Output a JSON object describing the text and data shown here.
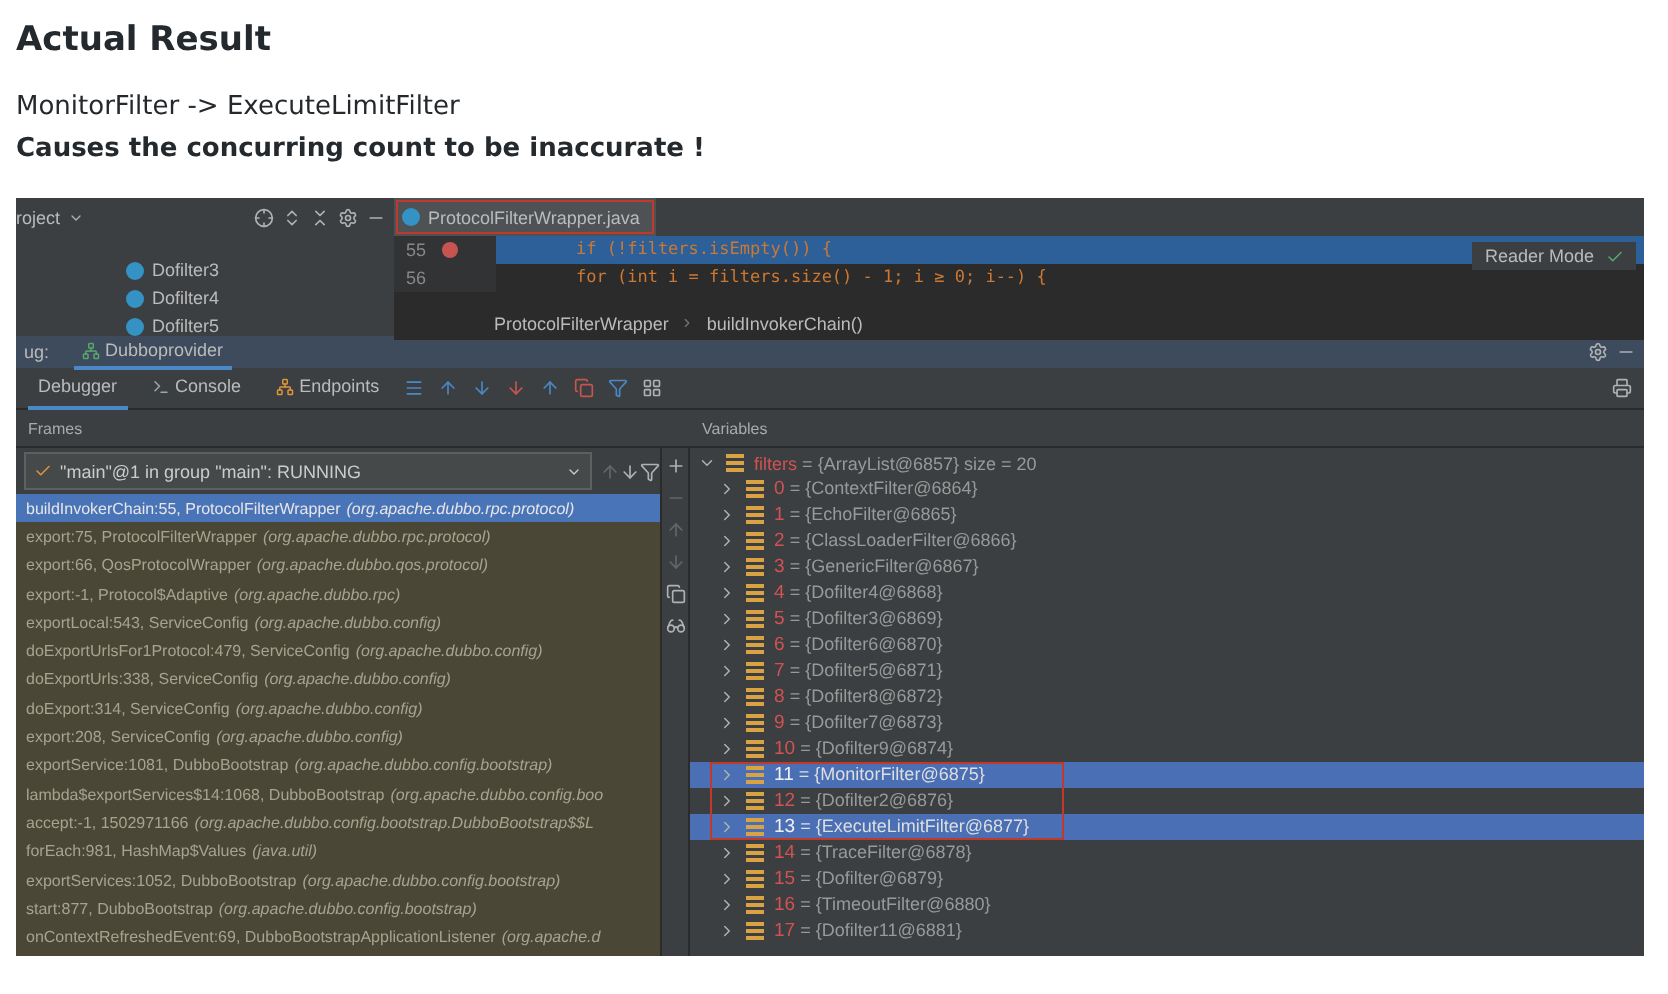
{
  "heading": "Actual Result",
  "lines": [
    {
      "text": "MonitorFilter -> ExecuteLimitFilter",
      "bold": false
    },
    {
      "text": "Causes the concurring count to be inaccurate !",
      "bold": true
    }
  ],
  "ide": {
    "project": {
      "title": "roject",
      "items": [
        "Dofilter3",
        "Dofilter4",
        "Dofilter5"
      ]
    },
    "editor": {
      "tab": {
        "label": "ProtocolFilterWrapper.java",
        "annotated": true
      },
      "lines": [
        {
          "number": "55",
          "code": "if (!filters.isEmpty()) {",
          "highlighted": true,
          "breakpoint": true
        },
        {
          "number": "56",
          "code": "for (int i = filters.size() - 1; i ≥ 0; i--) {",
          "highlighted": false,
          "breakpoint": false
        }
      ],
      "reader_mode": "Reader Mode",
      "breadcrumb": [
        "ProtocolFilterWrapper",
        "buildInvokerChain()"
      ]
    },
    "debug": {
      "label": "ug:",
      "session": "Dubboprovider",
      "tabs": [
        {
          "label": "Debugger",
          "selected": true
        },
        {
          "label": "Console",
          "selected": false
        },
        {
          "label": "Endpoints",
          "selected": false
        }
      ]
    },
    "frames": {
      "title": "Frames",
      "thread": "\"main\"@1 in group \"main\": RUNNING",
      "items": [
        {
          "method": "buildInvokerChain:55, ProtocolFilterWrapper",
          "package": "(org.apache.dubbo.rpc.protocol)",
          "selected": true
        },
        {
          "method": "export:75, ProtocolFilterWrapper",
          "package": "(org.apache.dubbo.rpc.protocol)",
          "selected": false
        },
        {
          "method": "export:66, QosProtocolWrapper",
          "package": "(org.apache.dubbo.qos.protocol)",
          "selected": false
        },
        {
          "method": "export:-1, Protocol$Adaptive",
          "package": "(org.apache.dubbo.rpc)",
          "selected": false
        },
        {
          "method": "exportLocal:543, ServiceConfig",
          "package": "(org.apache.dubbo.config)",
          "selected": false
        },
        {
          "method": "doExportUrlsFor1Protocol:479, ServiceConfig",
          "package": "(org.apache.dubbo.config)",
          "selected": false
        },
        {
          "method": "doExportUrls:338, ServiceConfig",
          "package": "(org.apache.dubbo.config)",
          "selected": false
        },
        {
          "method": "doExport:314, ServiceConfig",
          "package": "(org.apache.dubbo.config)",
          "selected": false
        },
        {
          "method": "export:208, ServiceConfig",
          "package": "(org.apache.dubbo.config)",
          "selected": false
        },
        {
          "method": "exportService:1081, DubboBootstrap",
          "package": "(org.apache.dubbo.config.bootstrap)",
          "selected": false
        },
        {
          "method": "lambda$exportServices$14:1068, DubboBootstrap",
          "package": "(org.apache.dubbo.config.boo",
          "selected": false
        },
        {
          "method": "accept:-1, 1502971166",
          "package": "(org.apache.dubbo.config.bootstrap.DubboBootstrap$$L",
          "selected": false
        },
        {
          "method": "forEach:981, HashMap$Values",
          "package": "(java.util)",
          "selected": false
        },
        {
          "method": "exportServices:1052, DubboBootstrap",
          "package": "(org.apache.dubbo.config.bootstrap)",
          "selected": false
        },
        {
          "method": "start:877, DubboBootstrap",
          "package": "(org.apache.dubbo.config.bootstrap)",
          "selected": false
        },
        {
          "method": "onContextRefreshedEvent:69, DubboBootstrapApplicationListener",
          "package": "(org.apache.d",
          "selected": false
        }
      ]
    },
    "variables": {
      "title": "Variables",
      "root": {
        "name": "filters",
        "value": "{ArrayList@6857}",
        "eq": "=",
        "size": "size = 20",
        "expanded": true,
        "children": [
          {
            "index": "0",
            "eq": "=",
            "value": "{ContextFilter@6864}",
            "selected": false,
            "marked": false
          },
          {
            "index": "1",
            "eq": "=",
            "value": "{EchoFilter@6865}",
            "selected": false,
            "marked": false
          },
          {
            "index": "2",
            "eq": "=",
            "value": "{ClassLoaderFilter@6866}",
            "selected": false,
            "marked": false
          },
          {
            "index": "3",
            "eq": "=",
            "value": "{GenericFilter@6867}",
            "selected": false,
            "marked": false
          },
          {
            "index": "4",
            "eq": "=",
            "value": "{Dofilter4@6868}",
            "selected": false,
            "marked": false
          },
          {
            "index": "5",
            "eq": "=",
            "value": "{Dofilter3@6869}",
            "selected": false,
            "marked": false
          },
          {
            "index": "6",
            "eq": "=",
            "value": "{Dofilter6@6870}",
            "selected": false,
            "marked": false
          },
          {
            "index": "7",
            "eq": "=",
            "value": "{Dofilter5@6871}",
            "selected": false,
            "marked": false
          },
          {
            "index": "8",
            "eq": "=",
            "value": "{Dofilter8@6872}",
            "selected": false,
            "marked": false
          },
          {
            "index": "9",
            "eq": "=",
            "value": "{Dofilter7@6873}",
            "selected": false,
            "marked": false
          },
          {
            "index": "10",
            "eq": "=",
            "value": "{Dofilter9@6874}",
            "selected": false,
            "marked": false
          },
          {
            "index": "11",
            "eq": "=",
            "value": "{MonitorFilter@6875}",
            "selected": true,
            "marked": true
          },
          {
            "index": "12",
            "eq": "=",
            "value": "{Dofilter2@6876}",
            "selected": false,
            "marked": true
          },
          {
            "index": "13",
            "eq": "=",
            "value": "{ExecuteLimitFilter@6877}",
            "selected": true,
            "marked": true
          },
          {
            "index": "14",
            "eq": "=",
            "value": "{TraceFilter@6878}",
            "selected": false,
            "marked": false
          },
          {
            "index": "15",
            "eq": "=",
            "value": "{Dofilter@6879}",
            "selected": false,
            "marked": false
          },
          {
            "index": "16",
            "eq": "=",
            "value": "{TimeoutFilter@6880}",
            "selected": false,
            "marked": false
          },
          {
            "index": "17",
            "eq": "=",
            "value": "{Dofilter11@6881}",
            "selected": false,
            "marked": false
          }
        ]
      }
    }
  }
}
